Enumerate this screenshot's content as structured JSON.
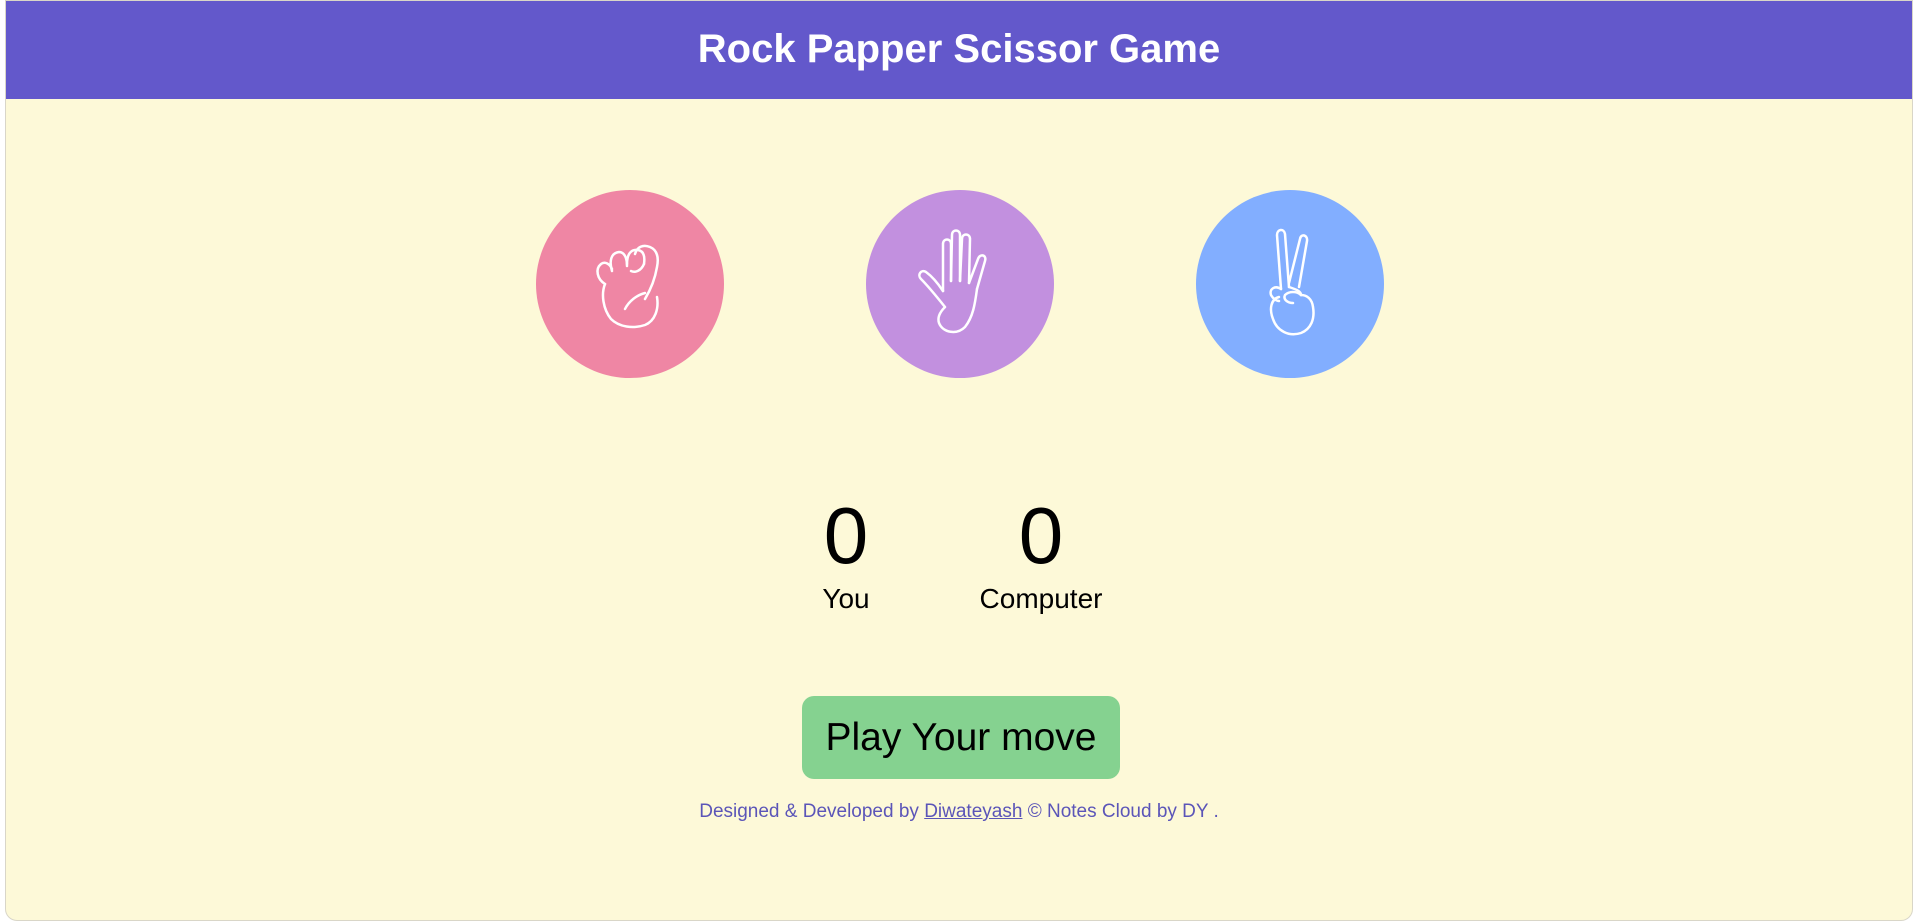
{
  "header": {
    "title": "Rock Papper Scissor Game"
  },
  "choices": [
    {
      "id": "rock",
      "icon": "fist-icon",
      "color": "#ef86a4"
    },
    {
      "id": "paper",
      "icon": "open-hand-icon",
      "color": "#c290df"
    },
    {
      "id": "scissor",
      "icon": "peace-hand-icon",
      "color": "#82aeff"
    }
  ],
  "scores": {
    "you": {
      "value": "0",
      "label": "You"
    },
    "computer": {
      "value": "0",
      "label": "Computer"
    }
  },
  "play_button": {
    "label": "Play Your move",
    "color": "#85d290"
  },
  "footer": {
    "prefix": "Designed & Developed by ",
    "author": "Diwateyash",
    "suffix": " © Notes Cloud by DY ."
  },
  "colors": {
    "header_bg": "#6358cb",
    "page_bg": "#fdf9d8",
    "footer_text": "#5b55b8"
  }
}
